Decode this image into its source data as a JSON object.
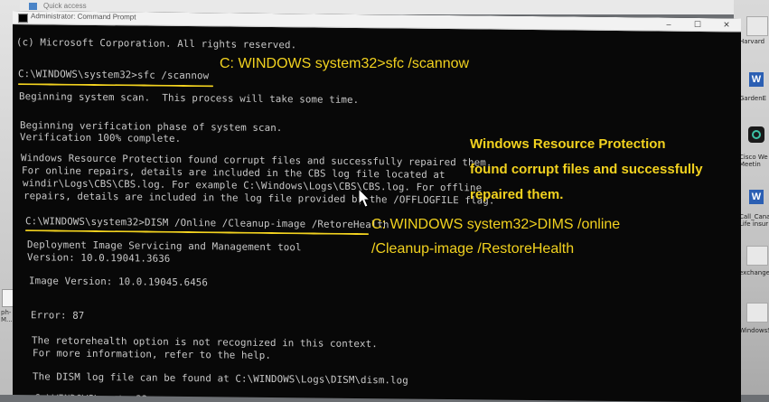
{
  "background_window": {
    "quick_access": "Quick access"
  },
  "cmd_window": {
    "title": "Administrator: Command Prompt",
    "min": "–",
    "max": "☐",
    "close": "✕"
  },
  "terminal": {
    "lines": [
      "(c) Microsoft Corporation. All rights reserved.",
      "C:\\WINDOWS\\system32>sfc /scannow",
      "Beginning system scan.  This process will take some time.",
      "Beginning verification phase of system scan.",
      "Verification 100% complete.",
      "Windows Resource Protection found corrupt files and successfully repaired them.",
      "For online repairs, details are included in the CBS log file located at",
      "windir\\Logs\\CBS\\CBS.log. For example C:\\Windows\\Logs\\CBS\\CBS.log. For offline",
      "repairs, details are included in the log file provided by the /OFFLOGFILE flag.",
      "C:\\WINDOWS\\system32>DISM /Online /Cleanup-image /RetoreHealth",
      "Deployment Image Servicing and Management tool",
      "Version: 10.0.19041.3636",
      "Image Version: 10.0.19045.6456",
      "Error: 87",
      "The retorehealth option is not recognized in this context.",
      "For more information, refer to the help.",
      "The DISM log file can be found at C:\\WINDOWS\\Logs\\DISM\\dism.log",
      "C:\\WINDOWS\\system32>"
    ]
  },
  "annotations": {
    "sfc": "C: WINDOWS system32>sfc /scannow",
    "wrp_1": "Windows Resource Protection",
    "wrp_2": "found corrupt files and successfully",
    "wrp_3": "repaired them.",
    "dism_1": "C: WINDOWS system32>DIMS /online",
    "dism_2": "/Cleanup-image /RestoreHealth"
  },
  "right_desktop": {
    "items": [
      "Harvard",
      "GardenE",
      "Cisco We\nMeetin",
      "Call_Cana\nLife insur",
      "exchange",
      "WindowsS"
    ]
  },
  "left_desktop": {
    "items": [
      "ph-\nM..."
    ]
  },
  "colors": {
    "terminal_bg": "#080808",
    "terminal_text": "#c8c8c8",
    "annotation": "#f2d21f"
  }
}
